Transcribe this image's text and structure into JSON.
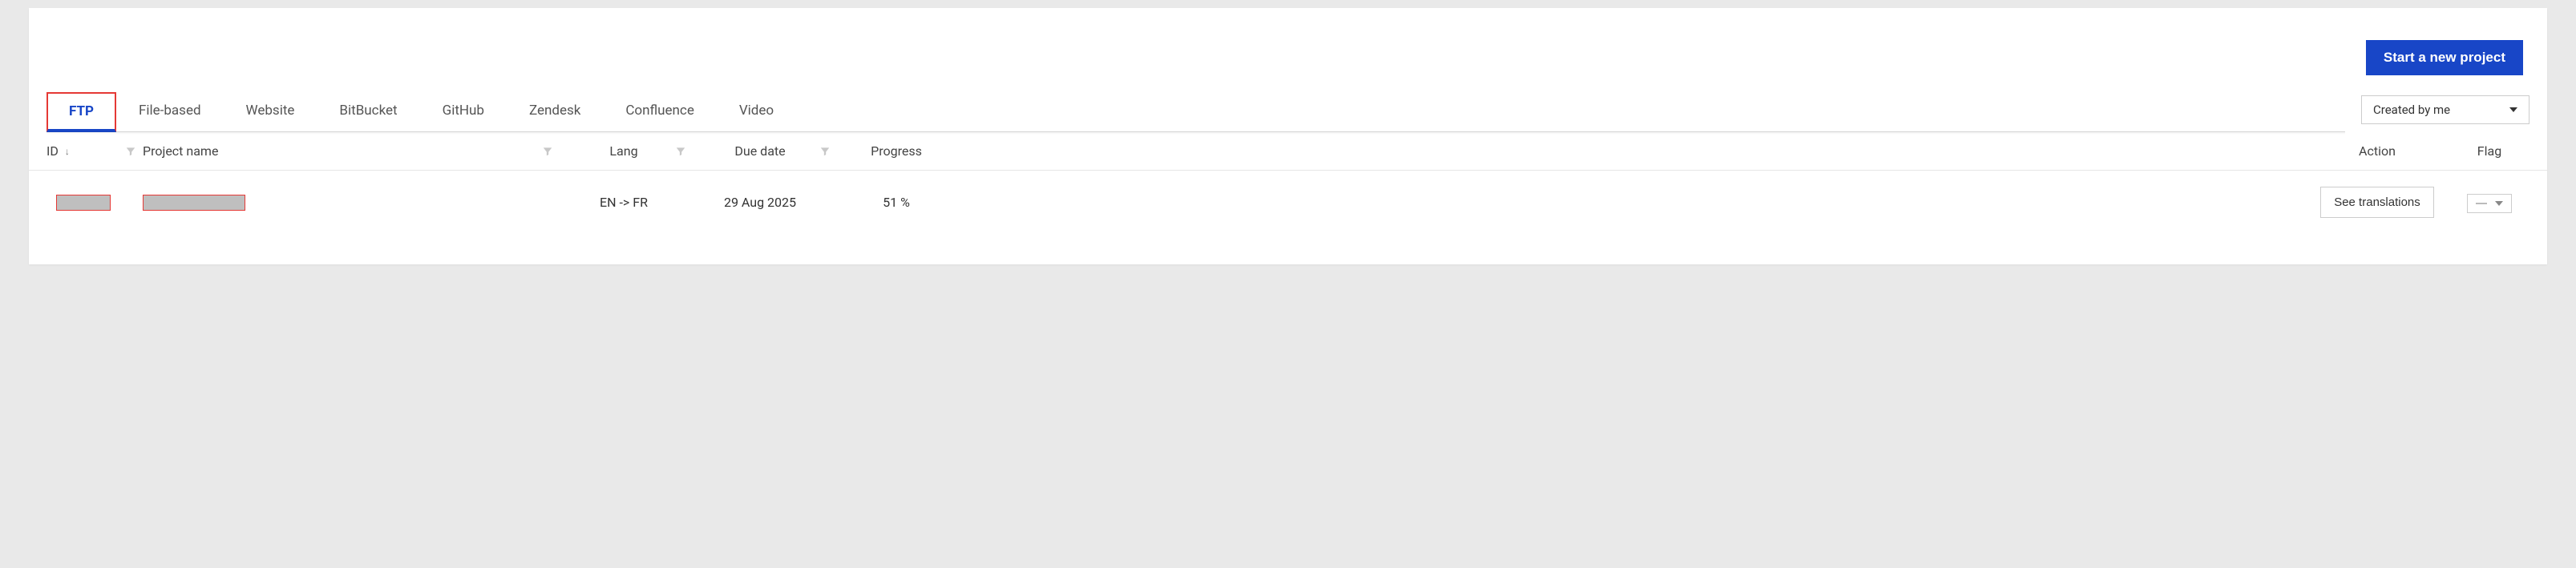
{
  "header": {
    "new_project_label": "Start a new project"
  },
  "tabs": {
    "items": [
      {
        "label": "FTP",
        "active": true
      },
      {
        "label": "File-based",
        "active": false
      },
      {
        "label": "Website",
        "active": false
      },
      {
        "label": "BitBucket",
        "active": false
      },
      {
        "label": "GitHub",
        "active": false
      },
      {
        "label": "Zendesk",
        "active": false
      },
      {
        "label": "Confluence",
        "active": false
      },
      {
        "label": "Video",
        "active": false
      }
    ],
    "filter_selected": "Created by me"
  },
  "columns": {
    "id": "ID",
    "project_name": "Project name",
    "lang": "Lang",
    "due": "Due date",
    "progress": "Progress",
    "action": "Action",
    "flag": "Flag"
  },
  "rows": [
    {
      "id_redacted": true,
      "name_redacted": true,
      "lang": "EN -> FR",
      "due": "29 Aug 2025",
      "progress": "51 %",
      "action_label": "See translations"
    }
  ]
}
